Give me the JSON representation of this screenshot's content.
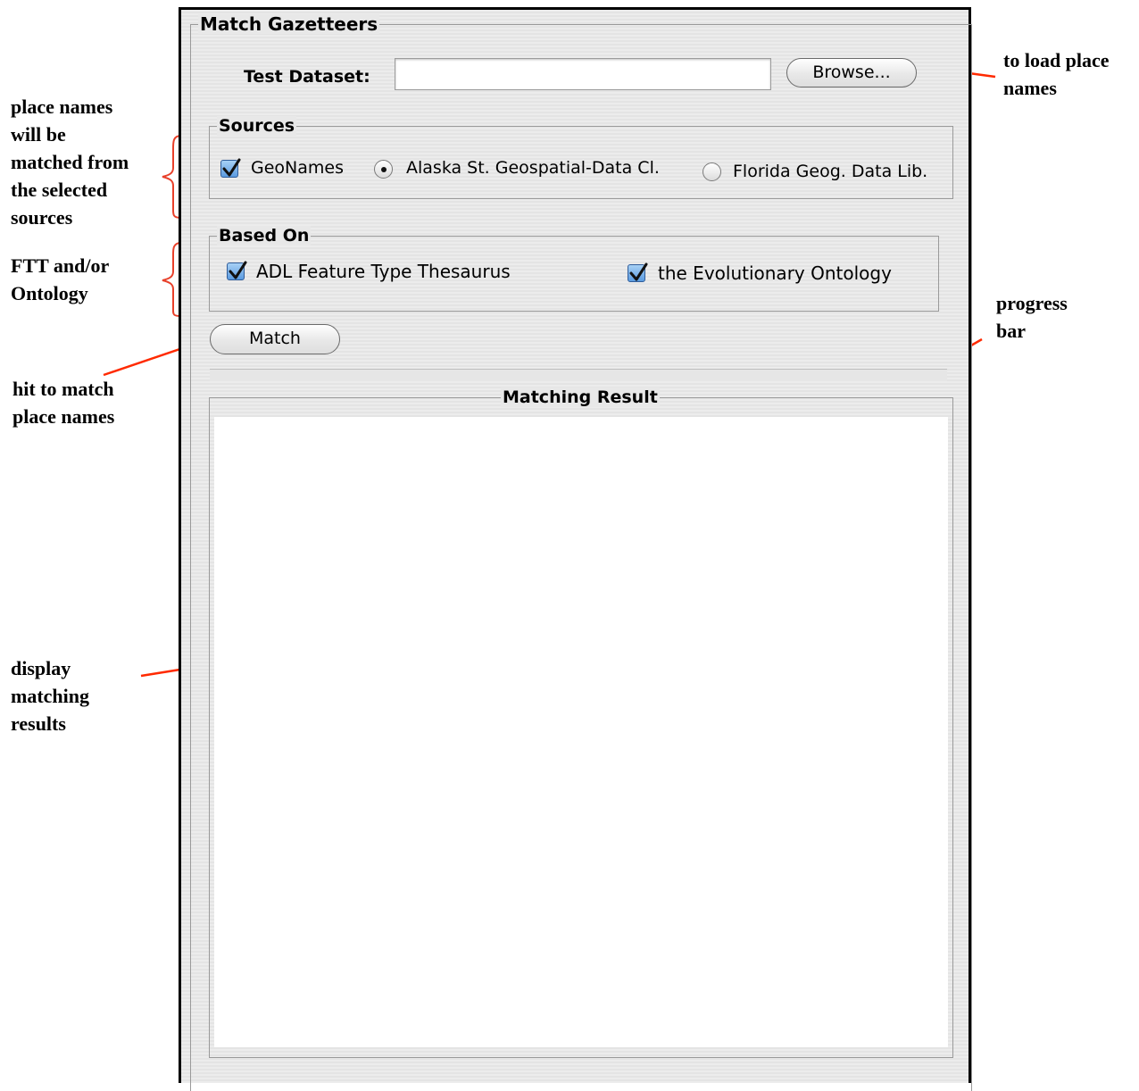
{
  "window": {
    "title": "Match Gazetteers",
    "test_dataset": {
      "label": "Test Dataset:",
      "value": "",
      "placeholder": ""
    },
    "browse_label": "Browse...",
    "sources": {
      "title": "Sources",
      "options": [
        {
          "label": "GeoNames",
          "type": "checkbox",
          "checked": true
        },
        {
          "label": "Alaska St. Geospatial-Data Cl.",
          "type": "radio",
          "selected": true
        },
        {
          "label": "Florida Geog. Data Lib.",
          "type": "radio",
          "selected": false
        }
      ]
    },
    "based_on": {
      "title": "Based On",
      "options": [
        {
          "label": "ADL Feature Type Thesaurus",
          "checked": true
        },
        {
          "label": "the Evolutionary Ontology",
          "checked": true
        }
      ]
    },
    "match_label": "Match",
    "progress": 0,
    "results_title": "Matching Result",
    "results_text": ""
  },
  "annotations": {
    "load": "to load place\nnames",
    "sources": "place names\nwill be\nmatched from\nthe selected\nsources",
    "ontology": "FTT and/or\nOntology",
    "progress": "progress\nbar",
    "match": "hit to match\nplace names",
    "results": "display\nmatching\nresults"
  },
  "colors": {
    "arrow": "#ff2a00",
    "bracket": "#e8402a",
    "checkbox": "#5b9be0"
  }
}
